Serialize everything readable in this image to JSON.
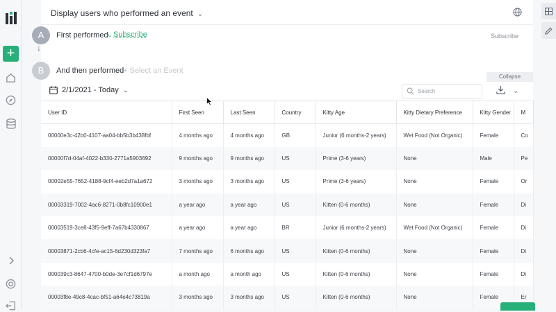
{
  "header": {
    "title": "Display users who performed an event"
  },
  "steps": [
    {
      "letter": "A",
      "label": "First performed",
      "event": "Subscribe",
      "right_label": "Subscribe",
      "color": "#a7adb6"
    },
    {
      "letter": "B",
      "label": "And then performed",
      "event_placeholder": "+ Select an Event",
      "color": "#c9cdd3"
    }
  ],
  "collapse_label": "Collapse",
  "toolbar": {
    "date_range": "2/1/2021 - Today",
    "search_placeholder": "Search"
  },
  "table": {
    "columns": [
      "User ID",
      "First Seen",
      "Last Seen",
      "Country",
      "Kitty Age",
      "Kitty Dietary Preference",
      "Kitty Gender",
      "M"
    ],
    "rows": [
      [
        "00000e3c-42b0-4107-aa04-bb5b3b438fbf",
        "4 months ago",
        "4 months ago",
        "GB",
        "Junior (6 months-2 years)",
        "Wet Food (Not Organic)",
        "Female",
        "Co"
      ],
      [
        "00000f7d-04af-4022-b330-2771a5903692",
        "9 months ago",
        "9 months ago",
        "US",
        "Prime (3-6 years)",
        "None",
        "Male",
        "Pe"
      ],
      [
        "00002e55-7652-4188-9cf4-eeb2d7a1a672",
        "3 months ago",
        "3 months ago",
        "US",
        "Prime (3-6 years)",
        "None",
        "Female",
        "Or"
      ],
      [
        "00003319-7002-4ac6-8271-0b8fc10900e1",
        "a year ago",
        "a year ago",
        "US",
        "Kitten (0-6 months)",
        "None",
        "Female",
        "Di"
      ],
      [
        "00003519-3ce8-43f5-9eff-7a67b4330867",
        "a year ago",
        "a year ago",
        "BR",
        "Junior (6 months-2 years)",
        "Wet Food (Not Organic)",
        "Female",
        "Di"
      ],
      [
        "00003871-2cb6-4cfe-ac15-6d230d323fa7",
        "7 months ago",
        "6 months ago",
        "US",
        "Kitten (0-6 months)",
        "None",
        "Female",
        "Di"
      ],
      [
        "000039c3-8647-4700-b0de-3e7cf1d6797e",
        "a month ago",
        "a month ago",
        "US",
        "Kitten (0-6 months)",
        "None",
        "Female",
        "Di"
      ],
      [
        "00003f8e-49c8-4cac-bf51-a64e4c73819a",
        "3 months ago",
        "3 months ago",
        "US",
        "Kitten (0-6 months)",
        "None",
        "Female",
        "Er"
      ]
    ]
  },
  "colors": {
    "accent": "#27b07a"
  }
}
